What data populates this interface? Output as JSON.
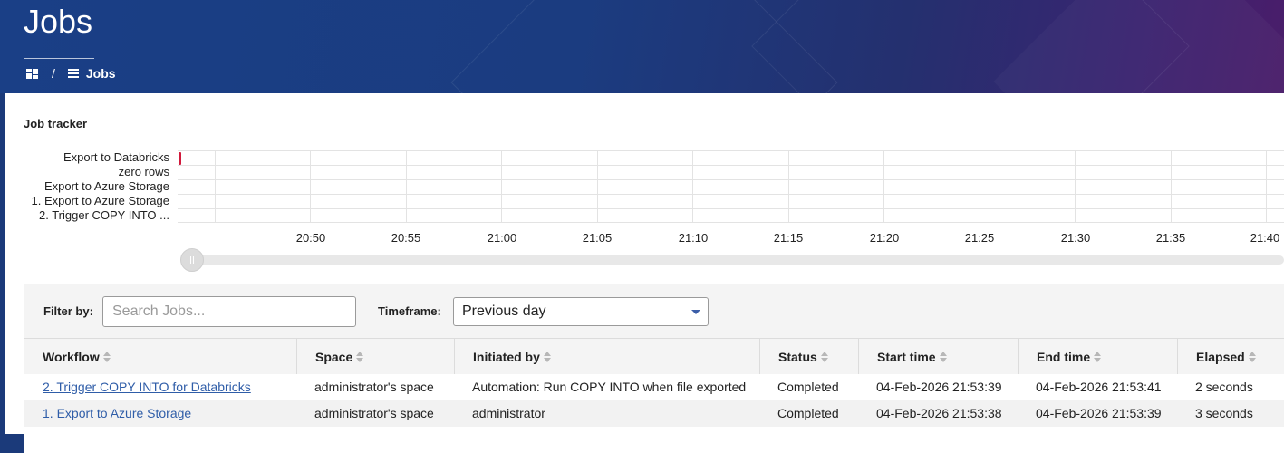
{
  "header": {
    "title": "Jobs",
    "breadcrumb": {
      "current": "Jobs",
      "separator": "/"
    }
  },
  "tracker": {
    "title": "Job tracker",
    "rows": [
      "Export to Databricks",
      "zero rows",
      "Export to Azure Storage",
      "1. Export to Azure Storage",
      "2. Trigger COPY INTO ..."
    ],
    "ticks": [
      "20:50",
      "20:55",
      "21:00",
      "21:05",
      "21:10",
      "21:15",
      "21:20",
      "21:25",
      "21:30",
      "21:35",
      "21:40"
    ],
    "bar_color": "#d11a3c"
  },
  "filters": {
    "filter_label": "Filter by:",
    "search_placeholder": "Search Jobs...",
    "timeframe_label": "Timeframe:",
    "timeframe_value": "Previous day"
  },
  "table": {
    "columns": [
      "Workflow",
      "Space",
      "Initiated by",
      "Status",
      "Start time",
      "End time",
      "Elapsed"
    ],
    "rows": [
      {
        "workflow": "2. Trigger COPY INTO for Databricks",
        "space": "administrator's space",
        "initiated_by": "Automation: Run COPY INTO when file exported",
        "status": "Completed",
        "start": "04-Feb-2026 21:53:39",
        "end": "04-Feb-2026 21:53:41",
        "elapsed": "2 seconds"
      },
      {
        "workflow": "1. Export to Azure Storage",
        "space": "administrator's space",
        "initiated_by": "administrator",
        "status": "Completed",
        "start": "04-Feb-2026 21:53:38",
        "end": "04-Feb-2026 21:53:39",
        "elapsed": "3 seconds"
      }
    ]
  },
  "colors": {
    "link": "#2f5da8",
    "header_start": "#1a3f86",
    "header_end": "#4a1d6a"
  }
}
